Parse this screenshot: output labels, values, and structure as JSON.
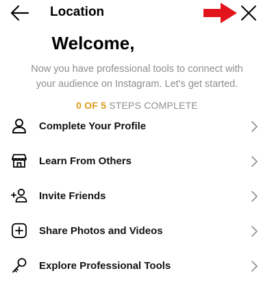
{
  "header": {
    "title": "Location",
    "back_icon": "back-arrow-icon",
    "close_icon": "close-icon",
    "annotation_color": "#e3141b"
  },
  "intro": {
    "heading": "Welcome,",
    "subtitle_line1": "Now you have professional tools to connect with",
    "subtitle_line2": "your audience on Instagram. Let's get started.",
    "steps_count": "0 OF 5",
    "steps_label": " STEPS COMPLETE",
    "steps_count_color": "#d99a1c"
  },
  "steps": [
    {
      "label": "Complete Your Profile",
      "icon": "person-icon"
    },
    {
      "label": "Learn From Others",
      "icon": "storefront-icon"
    },
    {
      "label": "Invite Friends",
      "icon": "add-person-icon"
    },
    {
      "label": "Share Photos and Videos",
      "icon": "plus-square-icon"
    },
    {
      "label": "Explore Professional Tools",
      "icon": "key-icon"
    }
  ]
}
